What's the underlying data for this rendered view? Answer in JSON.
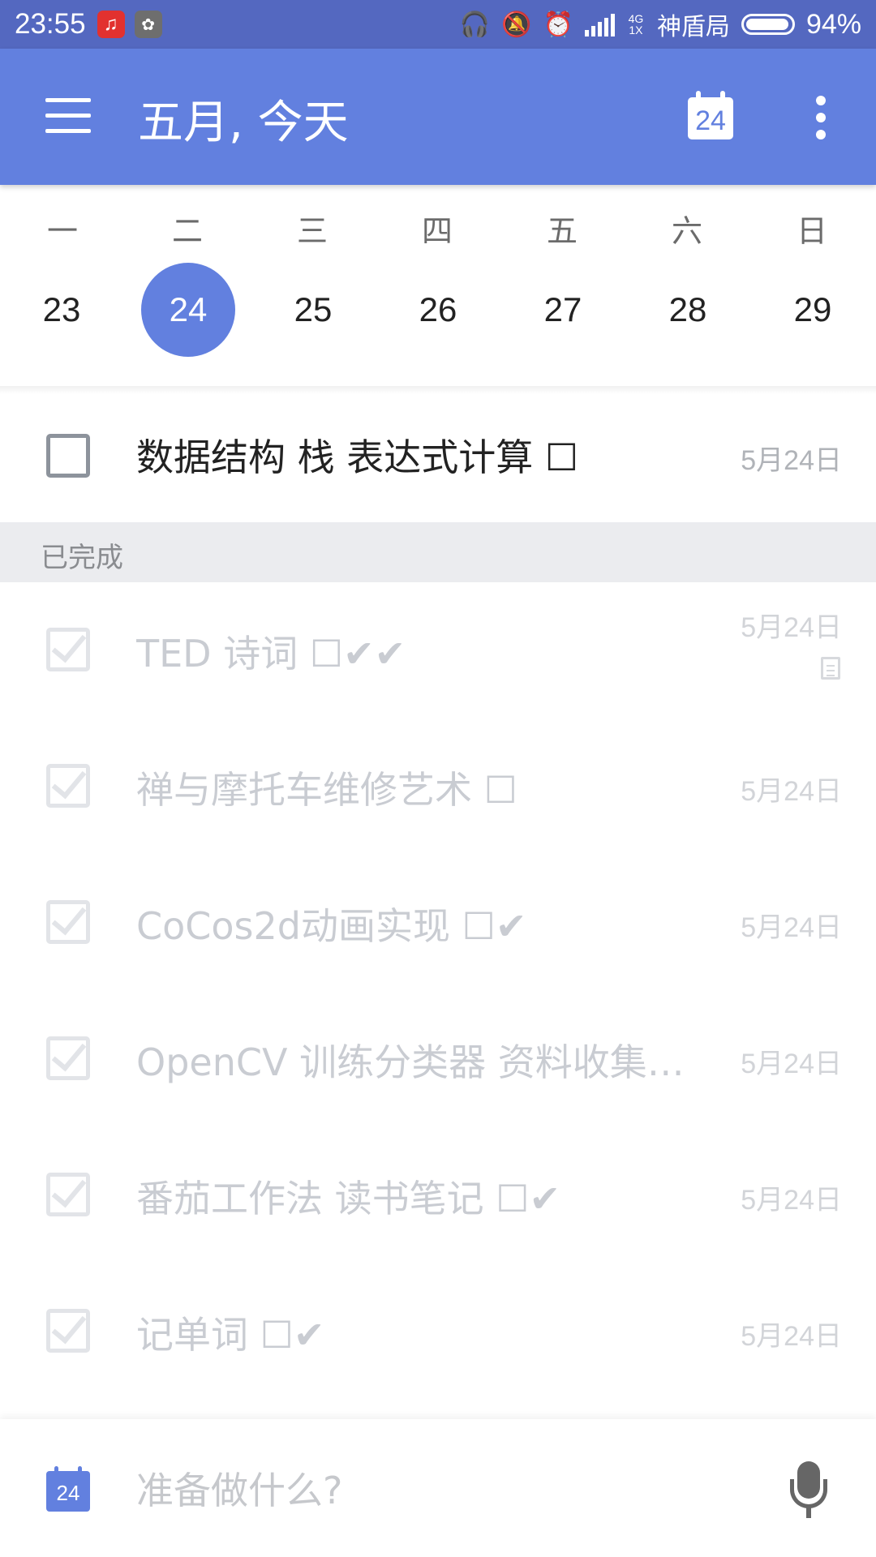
{
  "status_bar": {
    "time": "23:55",
    "network_label": "4G 1X",
    "carrier": "神盾局",
    "battery_percent": "94%"
  },
  "toolbar": {
    "title": "五月, 今天",
    "calendar_day": "24"
  },
  "week": {
    "weekdays": [
      "一",
      "二",
      "三",
      "四",
      "五",
      "六",
      "日"
    ],
    "days": [
      "23",
      "24",
      "25",
      "26",
      "27",
      "28",
      "29"
    ],
    "selected_day": "24"
  },
  "tasks": [
    {
      "text": "数据结构 栈 表达式计算 ☐",
      "date": "5月24日",
      "completed": false
    }
  ],
  "completed_section": {
    "label": "已完成",
    "tasks": [
      {
        "text": "TED 诗词 ☐✔✔",
        "date": "5月24日",
        "has_note": true
      },
      {
        "text": "禅与摩托车维修艺术 ☐",
        "date": "5月24日"
      },
      {
        "text": "CoCos2d动画实现 ☐✔",
        "date": "5月24日"
      },
      {
        "text": "OpenCV 训练分类器 资料收集☐...",
        "date": "5月24日"
      },
      {
        "text": "番茄工作法 读书笔记 ☐✔",
        "date": "5月24日"
      },
      {
        "text": "记单词 ☐✔",
        "date": "5月24日"
      }
    ]
  },
  "input_bar": {
    "calendar_day": "24",
    "placeholder": "准备做什么?"
  },
  "colors": {
    "status_bar": "#5468c0",
    "toolbar": "#6280df",
    "accent": "#6280df",
    "section_header_bg": "#ebecef"
  }
}
